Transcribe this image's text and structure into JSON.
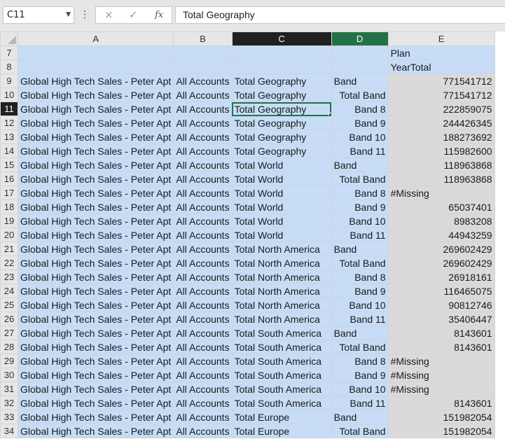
{
  "formula_bar": {
    "name_box": "C11",
    "formula": "Total Geography",
    "cancel_icon": "×",
    "enter_icon": "✓",
    "fx_label": "fx"
  },
  "columns": [
    "A",
    "B",
    "C",
    "D",
    "E"
  ],
  "rows": [
    {
      "n": "7",
      "a": "",
      "b": "",
      "c": "",
      "d": "",
      "e": "Plan"
    },
    {
      "n": "8",
      "a": "",
      "b": "",
      "c": "",
      "d": "",
      "e": "YearTotal"
    },
    {
      "n": "9",
      "a": "Global High Tech Sales - Peter Apt",
      "b": "All Accounts",
      "c": "Total Geography",
      "d": "Band",
      "e": "771541712"
    },
    {
      "n": "10",
      "a": "Global High Tech Sales - Peter Apt",
      "b": "All Accounts",
      "c": "Total Geography",
      "d": "Total Band",
      "e": "771541712"
    },
    {
      "n": "11",
      "a": "Global High Tech Sales - Peter Apt",
      "b": "All Accounts",
      "c": "Total Geography",
      "d": "Band 8",
      "e": "222859075"
    },
    {
      "n": "12",
      "a": "Global High Tech Sales - Peter Apt",
      "b": "All Accounts",
      "c": "Total Geography",
      "d": "Band 9",
      "e": "244426345"
    },
    {
      "n": "13",
      "a": "Global High Tech Sales - Peter Apt",
      "b": "All Accounts",
      "c": "Total Geography",
      "d": "Band 10",
      "e": "188273692"
    },
    {
      "n": "14",
      "a": "Global High Tech Sales - Peter Apt",
      "b": "All Accounts",
      "c": "Total Geography",
      "d": "Band 11",
      "e": "115982600"
    },
    {
      "n": "15",
      "a": "Global High Tech Sales - Peter Apt",
      "b": "All Accounts",
      "c": "Total World",
      "d": "Band",
      "e": "118963868"
    },
    {
      "n": "16",
      "a": "Global High Tech Sales - Peter Apt",
      "b": "All Accounts",
      "c": "Total World",
      "d": "Total Band",
      "e": "118963868"
    },
    {
      "n": "17",
      "a": "Global High Tech Sales - Peter Apt",
      "b": "All Accounts",
      "c": "Total World",
      "d": "Band 8",
      "e": "#Missing"
    },
    {
      "n": "18",
      "a": "Global High Tech Sales - Peter Apt",
      "b": "All Accounts",
      "c": "Total World",
      "d": "Band 9",
      "e": "65037401"
    },
    {
      "n": "19",
      "a": "Global High Tech Sales - Peter Apt",
      "b": "All Accounts",
      "c": "Total World",
      "d": "Band 10",
      "e": "8983208"
    },
    {
      "n": "20",
      "a": "Global High Tech Sales - Peter Apt",
      "b": "All Accounts",
      "c": "Total World",
      "d": "Band 11",
      "e": "44943259"
    },
    {
      "n": "21",
      "a": "Global High Tech Sales - Peter Apt",
      "b": "All Accounts",
      "c": "Total North America",
      "d": "Band",
      "e": "269602429"
    },
    {
      "n": "22",
      "a": "Global High Tech Sales - Peter Apt",
      "b": "All Accounts",
      "c": "Total North America",
      "d": "Total Band",
      "e": "269602429"
    },
    {
      "n": "23",
      "a": "Global High Tech Sales - Peter Apt",
      "b": "All Accounts",
      "c": "Total North America",
      "d": "Band 8",
      "e": "26918161"
    },
    {
      "n": "24",
      "a": "Global High Tech Sales - Peter Apt",
      "b": "All Accounts",
      "c": "Total North America",
      "d": "Band 9",
      "e": "116465075"
    },
    {
      "n": "25",
      "a": "Global High Tech Sales - Peter Apt",
      "b": "All Accounts",
      "c": "Total North America",
      "d": "Band 10",
      "e": "90812746"
    },
    {
      "n": "26",
      "a": "Global High Tech Sales - Peter Apt",
      "b": "All Accounts",
      "c": "Total North America",
      "d": "Band 11",
      "e": "35406447"
    },
    {
      "n": "27",
      "a": "Global High Tech Sales - Peter Apt",
      "b": "All Accounts",
      "c": "Total South America",
      "d": "Band",
      "e": "8143601"
    },
    {
      "n": "28",
      "a": "Global High Tech Sales - Peter Apt",
      "b": "All Accounts",
      "c": "Total South America",
      "d": "Total Band",
      "e": "8143601"
    },
    {
      "n": "29",
      "a": "Global High Tech Sales - Peter Apt",
      "b": "All Accounts",
      "c": "Total South America",
      "d": "Band 8",
      "e": "#Missing"
    },
    {
      "n": "30",
      "a": "Global High Tech Sales - Peter Apt",
      "b": "All Accounts",
      "c": "Total South America",
      "d": "Band 9",
      "e": "#Missing"
    },
    {
      "n": "31",
      "a": "Global High Tech Sales - Peter Apt",
      "b": "All Accounts",
      "c": "Total South America",
      "d": "Band 10",
      "e": "#Missing"
    },
    {
      "n": "32",
      "a": "Global High Tech Sales - Peter Apt",
      "b": "All Accounts",
      "c": "Total South America",
      "d": "Band 11",
      "e": "8143601"
    },
    {
      "n": "33",
      "a": "Global High Tech Sales - Peter Apt",
      "b": "All Accounts",
      "c": "Total Europe",
      "d": "Band",
      "e": "151982054"
    },
    {
      "n": "34",
      "a": "Global High Tech Sales - Peter Apt",
      "b": "All Accounts",
      "c": "Total Europe",
      "d": "Total Band",
      "e": "151982054"
    }
  ]
}
